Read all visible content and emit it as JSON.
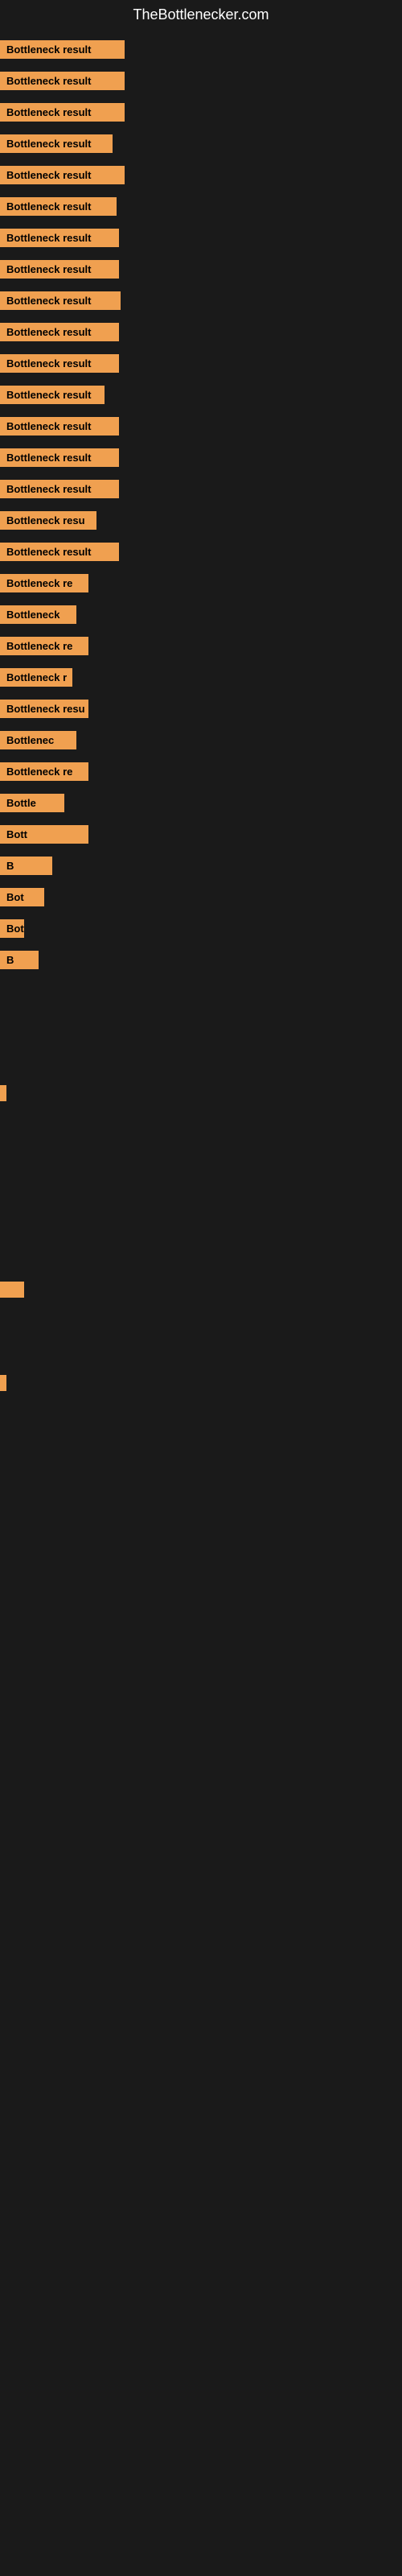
{
  "site": {
    "title": "TheBottlenecker.com"
  },
  "bars": [
    {
      "id": 1,
      "label": "Bottleneck result",
      "width_class": "bar-1"
    },
    {
      "id": 2,
      "label": "Bottleneck result",
      "width_class": "bar-2"
    },
    {
      "id": 3,
      "label": "Bottleneck result",
      "width_class": "bar-3"
    },
    {
      "id": 4,
      "label": "Bottleneck result",
      "width_class": "bar-4"
    },
    {
      "id": 5,
      "label": "Bottleneck result",
      "width_class": "bar-5"
    },
    {
      "id": 6,
      "label": "Bottleneck result",
      "width_class": "bar-6"
    },
    {
      "id": 7,
      "label": "Bottleneck result",
      "width_class": "bar-7"
    },
    {
      "id": 8,
      "label": "Bottleneck result",
      "width_class": "bar-8"
    },
    {
      "id": 9,
      "label": "Bottleneck result",
      "width_class": "bar-9"
    },
    {
      "id": 10,
      "label": "Bottleneck result",
      "width_class": "bar-10"
    },
    {
      "id": 11,
      "label": "Bottleneck result",
      "width_class": "bar-11"
    },
    {
      "id": 12,
      "label": "Bottleneck result",
      "width_class": "bar-12"
    },
    {
      "id": 13,
      "label": "Bottleneck result",
      "width_class": "bar-13"
    },
    {
      "id": 14,
      "label": "Bottleneck result",
      "width_class": "bar-14"
    },
    {
      "id": 15,
      "label": "Bottleneck result",
      "width_class": "bar-15"
    },
    {
      "id": 16,
      "label": "Bottleneck resu",
      "width_class": "bar-16"
    },
    {
      "id": 17,
      "label": "Bottleneck result",
      "width_class": "bar-17"
    },
    {
      "id": 18,
      "label": "Bottleneck re",
      "width_class": "bar-18"
    },
    {
      "id": 19,
      "label": "Bottleneck",
      "width_class": "bar-19"
    },
    {
      "id": 20,
      "label": "Bottleneck re",
      "width_class": "bar-20"
    },
    {
      "id": 21,
      "label": "Bottleneck r",
      "width_class": "bar-21"
    },
    {
      "id": 22,
      "label": "Bottleneck resu",
      "width_class": "bar-22"
    },
    {
      "id": 23,
      "label": "Bottlenec",
      "width_class": "bar-23"
    },
    {
      "id": 24,
      "label": "Bottleneck re",
      "width_class": "bar-24"
    },
    {
      "id": 25,
      "label": "Bottle",
      "width_class": "bar-25"
    },
    {
      "id": 26,
      "label": "Bott",
      "width_class": "bar-26"
    },
    {
      "id": 27,
      "label": "B",
      "width_class": "bar-27"
    },
    {
      "id": 28,
      "label": "Bot",
      "width_class": "bar-28"
    },
    {
      "id": 29,
      "label": "Bottlen",
      "width_class": "bar-29"
    },
    {
      "id": 30,
      "label": "B",
      "width_class": "bar-30"
    }
  ],
  "colors": {
    "bar_fill": "#f0a050",
    "background": "#1a1a1a",
    "text": "#ffffff"
  }
}
